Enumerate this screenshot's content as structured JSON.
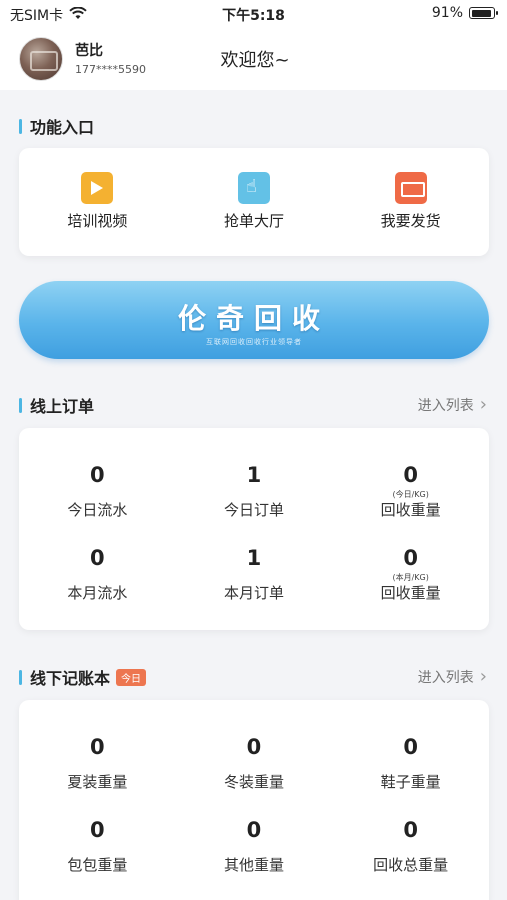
{
  "status": {
    "carrier": "无SIM卡",
    "time": "下午5:18",
    "battery": "91%",
    "battery_level": 0.91
  },
  "user": {
    "name": "芭比",
    "phone": "177****5590"
  },
  "welcome": "欢迎您~",
  "functions": {
    "title": "功能入口",
    "items": [
      {
        "label": "培训视频",
        "icon": "video-icon",
        "color": "#f4b131"
      },
      {
        "label": "抢单大厅",
        "icon": "tap-hand-icon",
        "color": "#63c1e6"
      },
      {
        "label": "我要发货",
        "icon": "delivery-truck-icon",
        "color": "#ef6a46"
      }
    ]
  },
  "banner": {
    "title": "伦奇回收",
    "subtitle": "互联网回收回收行业领导者"
  },
  "online_orders": {
    "title": "线上订单",
    "more": "进入列表",
    "stats": [
      {
        "value": "0",
        "label": "今日流水",
        "unit": ""
      },
      {
        "value": "1",
        "label": "今日订单",
        "unit": ""
      },
      {
        "value": "0",
        "label": "回收重量",
        "unit": "(今日/KG)"
      },
      {
        "value": "0",
        "label": "本月流水",
        "unit": ""
      },
      {
        "value": "1",
        "label": "本月订单",
        "unit": ""
      },
      {
        "value": "0",
        "label": "回收重量",
        "unit": "(本月/KG)"
      }
    ]
  },
  "offline_ledger": {
    "title": "线下记账本",
    "badge": "今日",
    "more": "进入列表",
    "stats": [
      {
        "value": "0",
        "label": "夏装重量"
      },
      {
        "value": "0",
        "label": "冬装重量"
      },
      {
        "value": "0",
        "label": "鞋子重量"
      },
      {
        "value": "0",
        "label": "包包重量"
      },
      {
        "value": "0",
        "label": "其他重量"
      },
      {
        "value": "0",
        "label": "回收总重量"
      }
    ]
  },
  "colors": {
    "accent": "#4cb6e3",
    "badge": "#ed7650",
    "banner": "#5ab4ea"
  }
}
